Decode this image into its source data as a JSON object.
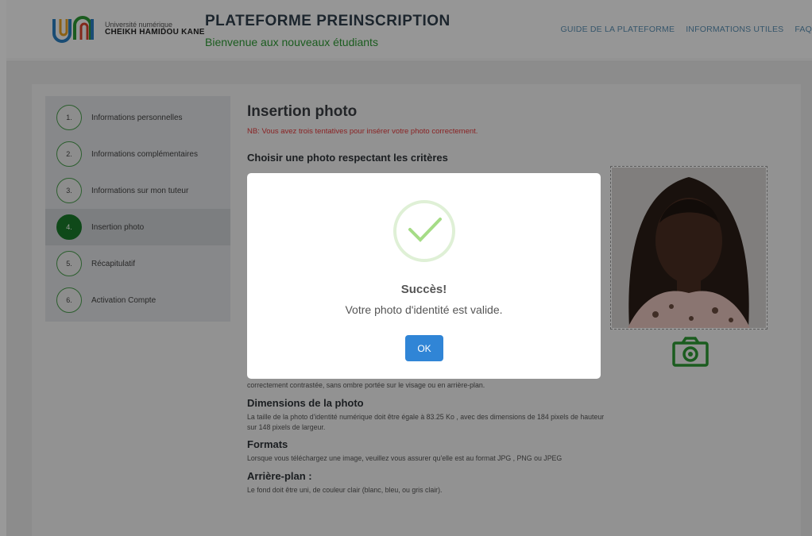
{
  "header": {
    "logo_line1": "Université numérique",
    "logo_line2": "CHEIKH HAMIDOU KANE",
    "title": "PLATEFORME PREINSCRIPTION",
    "subtitle": "Bienvenue aux nouveaux étudiants",
    "nav": [
      "GUIDE DE LA PLATEFORME",
      "INFORMATIONS UTILES",
      "FAQ"
    ]
  },
  "steps": [
    {
      "num": "1.",
      "label": "Informations personnelles",
      "active": false
    },
    {
      "num": "2.",
      "label": "Informations complémentaires",
      "active": false
    },
    {
      "num": "3.",
      "label": "Informations sur mon tuteur",
      "active": false
    },
    {
      "num": "4.",
      "label": "Insertion photo",
      "active": true
    },
    {
      "num": "5.",
      "label": "Récapitulatif",
      "active": false
    },
    {
      "num": "6.",
      "label": "Activation Compte",
      "active": false
    }
  ],
  "main": {
    "title": "Insertion photo",
    "nb": "NB: Vous avez trois tentatives pour insérer votre photo correctement.",
    "criteria_title": "Choisir une photo respectant les critères",
    "partial_text": "correctement contrastée, sans ombre portée sur le visage ou en arrière-plan.",
    "sections": [
      {
        "title": "Dimensions de la photo",
        "text": "La taille de la photo d'identité numérique doit être égale à 83.25 Ko , avec des dimensions de 184 pixels de hauteur sur 148 pixels de largeur."
      },
      {
        "title": "Formats",
        "text": "Lorsque vous téléchargez une image, veuillez vous assurer qu'elle est au format JPG , PNG ou JPEG"
      },
      {
        "title": "Arrière-plan :",
        "text": "Le fond doit être uni, de couleur clair (blanc, bleu, ou gris clair)."
      }
    ]
  },
  "modal": {
    "icon": "success-check-icon",
    "title": "Succès!",
    "message": "Votre photo d'identité est valide.",
    "ok_label": "OK"
  },
  "colors": {
    "brand_green": "#2e9a35",
    "active_step": "#1a7a2a",
    "nb_red": "#e5393b",
    "ok_button": "#3085d6",
    "nav_link": "#5b8fb3"
  }
}
